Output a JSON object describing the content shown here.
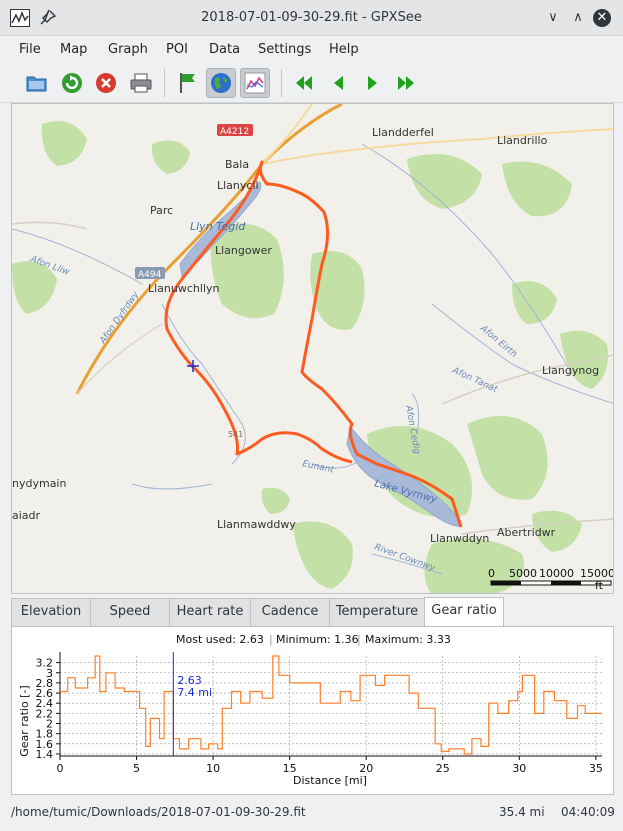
{
  "window": {
    "title": "2018-07-01-09-30-29.fit - GPXSee"
  },
  "menu": [
    "File",
    "Map",
    "Graph",
    "POI",
    "Data",
    "Settings",
    "Help"
  ],
  "toolbar": {
    "icons": [
      "open-icon",
      "reload-icon",
      "close-file-icon",
      "print-icon",
      "poi-flag-icon",
      "map-globe-icon",
      "graph-icon",
      "first-file-icon",
      "previous-file-icon",
      "next-file-icon",
      "last-file-icon"
    ],
    "active": [
      "map-globe-icon",
      "graph-icon"
    ]
  },
  "map": {
    "labels": {
      "a4212": "A4212",
      "llandderfel": "Llandderfel",
      "llandrillo": "Llandrillo",
      "bala": "Bala",
      "llanycil": "Llanycil",
      "parc": "Parc",
      "llyn_tegid": "Llyn Tegid",
      "llangower": "Llangower",
      "a494": "A494",
      "afon_lliw": "Afon Lliw",
      "llanuwchllyn": "Llanuwchllyn",
      "afon_dyfrdwy": "Afon Dyfrdwy",
      "afon_eirth": "Afon Eirth",
      "llangynog": "Llangynog",
      "afon_tanat": "Afon Tanat",
      "afon_cedig": "Afon Cedig",
      "eunant": "Eunant",
      "lake_vyrnwy": "Lake Vyrnwy",
      "nydymain": "nydymain",
      "aiadr": "aiadr",
      "llanmawddwy": "Llanmawddwy",
      "abertridwr": "Abertridwr",
      "llanwddyn": "Llanwddyn",
      "river_cownwy": "River Cownwy",
      "spot_height": "541"
    },
    "scale": {
      "labels": [
        "0",
        "5000",
        "10000",
        "15000"
      ],
      "unit": "ft"
    },
    "colors": {
      "track": "#ff5a1f",
      "water": "#a8b9d9",
      "forest": "#bfdea0",
      "road": "#f0a830"
    }
  },
  "tabs": [
    "Elevation",
    "Speed",
    "Heart rate",
    "Cadence",
    "Temperature",
    "Gear ratio"
  ],
  "active_tab": "Gear ratio",
  "graph": {
    "info": {
      "most_used": "Most used: 2.63",
      "minimum": "Minimum: 1.36",
      "maximum": "Maximum: 3.33"
    },
    "cursor": {
      "value": "2.63",
      "distance": "7.4 mi"
    }
  },
  "chart_data": {
    "type": "line",
    "title": "",
    "xlabel": "Distance [mi]",
    "ylabel": "Gear ratio [-]",
    "xlim": [
      0,
      35.4
    ],
    "ylim": [
      1.36,
      3.33
    ],
    "x_ticks": [
      "0",
      "5",
      "10",
      "15",
      "20",
      "25",
      "30",
      "35"
    ],
    "y_ticks": [
      "1.4",
      "1.6",
      "1.8",
      "2",
      "2.2",
      "2.4",
      "2.6",
      "2.8",
      "3",
      "3.2"
    ],
    "grid": true,
    "color": "#ff7f2a",
    "x": [
      0,
      0.5,
      0.5,
      1.0,
      1.0,
      1.8,
      1.8,
      2.3,
      2.3,
      2.6,
      2.6,
      3.0,
      3.0,
      3.6,
      3.6,
      4.2,
      4.2,
      5.2,
      5.2,
      5.6,
      5.6,
      5.9,
      5.9,
      6.5,
      6.5,
      6.8,
      6.8,
      7.4,
      7.4,
      7.8,
      7.8,
      8.4,
      8.4,
      9.2,
      9.2,
      9.7,
      9.7,
      10.3,
      10.3,
      10.6,
      10.6,
      11.2,
      11.2,
      11.8,
      11.8,
      12.4,
      12.4,
      13.2,
      13.2,
      13.9,
      13.9,
      14.3,
      14.3,
      15.0,
      15.0,
      17.0,
      17.0,
      18.3,
      18.3,
      19.0,
      19.0,
      19.6,
      19.6,
      20.6,
      20.6,
      21.2,
      21.2,
      22.8,
      22.8,
      23.4,
      23.4,
      24.5,
      24.5,
      24.9,
      24.9,
      25.4,
      25.4,
      26.4,
      26.4,
      26.9,
      26.9,
      27.5,
      27.5,
      28.0,
      28.0,
      28.6,
      28.6,
      29.3,
      29.3,
      29.9,
      29.9,
      30.2,
      30.2,
      31.0,
      31.0,
      31.6,
      31.6,
      32.3,
      32.3,
      33.1,
      33.1,
      33.8,
      33.8,
      34.3,
      34.3,
      35.4
    ],
    "y": [
      2.63,
      2.63,
      2.9,
      2.9,
      2.7,
      2.7,
      2.9,
      2.9,
      3.33,
      3.33,
      2.63,
      2.63,
      3.0,
      3.0,
      2.7,
      2.7,
      2.63,
      2.63,
      2.3,
      2.3,
      1.55,
      1.55,
      2.1,
      2.1,
      1.7,
      1.7,
      2.63,
      2.63,
      1.7,
      1.7,
      1.5,
      1.5,
      1.7,
      1.7,
      1.5,
      1.5,
      1.6,
      1.6,
      1.5,
      1.5,
      2.3,
      2.3,
      2.63,
      2.63,
      2.4,
      2.4,
      2.63,
      2.63,
      2.5,
      2.5,
      3.33,
      3.33,
      2.95,
      2.95,
      2.8,
      2.8,
      2.4,
      2.4,
      2.63,
      2.63,
      2.45,
      2.45,
      2.95,
      2.95,
      2.75,
      2.75,
      2.95,
      2.95,
      2.6,
      2.6,
      2.3,
      2.3,
      1.6,
      1.6,
      1.45,
      1.45,
      1.5,
      1.5,
      1.4,
      1.4,
      1.7,
      1.7,
      1.55,
      1.55,
      2.4,
      2.4,
      2.2,
      2.2,
      2.45,
      2.45,
      2.63,
      2.63,
      2.95,
      2.95,
      2.2,
      2.2,
      2.63,
      2.63,
      2.45,
      2.45,
      2.1,
      2.1,
      2.35,
      2.35,
      2.2,
      2.2
    ]
  },
  "status": {
    "path": "/home/tumic/Downloads/2018-07-01-09-30-29.fit",
    "distance": "35.4 mi",
    "time": "04:40:09"
  }
}
